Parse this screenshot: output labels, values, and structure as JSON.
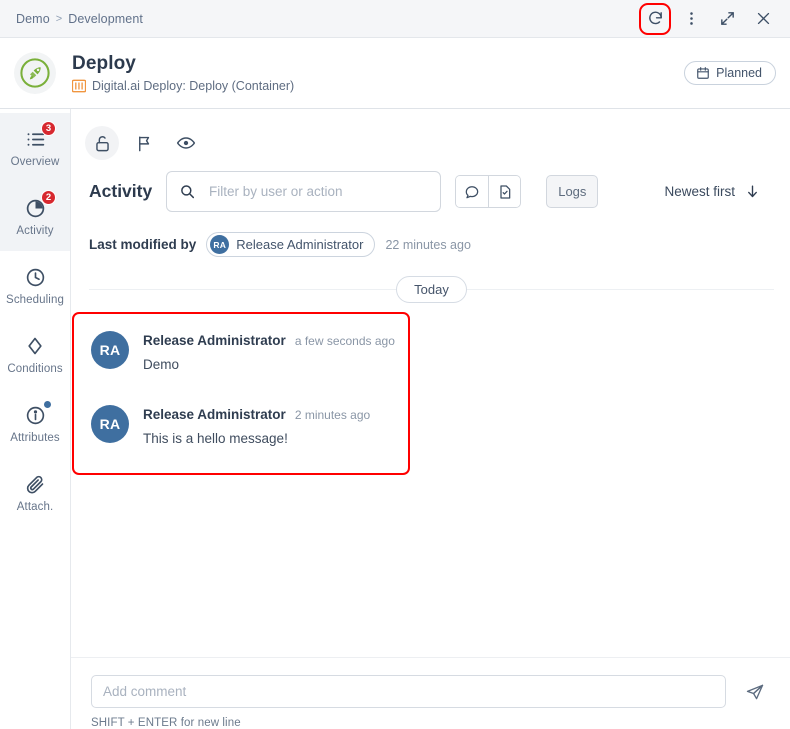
{
  "breadcrumb": {
    "items": [
      "Demo",
      "Development"
    ],
    "separator": ">"
  },
  "window_controls": {
    "refresh_label": "refresh",
    "more_label": "more options",
    "expand_label": "expand",
    "close_label": "close",
    "highlight_color": "#ff0000",
    "highlighted": "refresh"
  },
  "header": {
    "logo": "rocket-icon",
    "title": "Deploy",
    "subtitle": "Digital.ai Deploy: Deploy (Container)",
    "subtitle_icon": "digitalai-bars-icon",
    "status": {
      "label": "Planned",
      "icon": "calendar-icon"
    }
  },
  "sidebar": {
    "items": [
      {
        "label": "Overview",
        "icon": "list-icon",
        "badge": "3",
        "badge_color": "#d7282f",
        "active": true
      },
      {
        "label": "Activity",
        "icon": "pie-icon",
        "badge": "2",
        "badge_color": "#d7282f",
        "active": true
      },
      {
        "label": "Scheduling",
        "icon": "clock-icon",
        "badge": "",
        "badge_color": "",
        "active": false
      },
      {
        "label": "Conditions",
        "icon": "diamond-icon",
        "badge": "",
        "badge_color": "",
        "active": false
      },
      {
        "label": "Attributes",
        "icon": "info-icon",
        "badge": "dot",
        "badge_color": "#3f6fa0",
        "active": false
      },
      {
        "label": "Attach.",
        "icon": "paperclip-icon",
        "badge": "",
        "badge_color": "",
        "active": false
      }
    ]
  },
  "toolbar": {
    "lock_icon": "unlock-icon",
    "flag_icon": "flag-icon",
    "eye_icon": "eye-icon"
  },
  "activity": {
    "heading": "Activity",
    "search_placeholder": "Filter by user or action",
    "search_value": "",
    "search_icon": "search-icon",
    "segmented": [
      {
        "icon": "comment-bubble-icon",
        "name": "comments-filter"
      },
      {
        "icon": "document-check-icon",
        "name": "tasks-filter"
      }
    ],
    "logs_label": "Logs",
    "sort_label": "Newest first",
    "sort_icon": "arrow-down-icon"
  },
  "last_modified": {
    "label": "Last modified by",
    "user_initials": "RA",
    "user_name": "Release Administrator",
    "time": "22 minutes ago"
  },
  "date_divider": {
    "label": "Today"
  },
  "comments": {
    "highlighted": true,
    "highlight_color": "#ff0000",
    "items": [
      {
        "initials": "RA",
        "author": "Release Administrator",
        "time": "a few seconds ago",
        "text": "Demo",
        "avatar_color": "#3f6fa0"
      },
      {
        "initials": "RA",
        "author": "Release Administrator",
        "time": "2 minutes ago",
        "text": "This is a hello message!",
        "avatar_color": "#3f6fa0"
      }
    ]
  },
  "composer": {
    "placeholder": "Add comment",
    "value": "",
    "send_icon": "send-icon",
    "hint": "SHIFT + ENTER for new line"
  }
}
